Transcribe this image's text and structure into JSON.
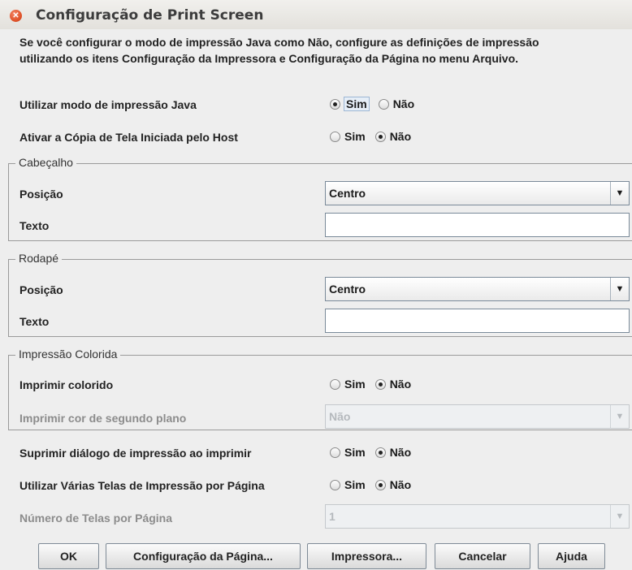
{
  "window": {
    "title": "Configuração de Print Screen",
    "close_icon": "close-icon"
  },
  "intro": "Se você configurar o modo de impressão Java como Não, configure as definições de impressão utilizando os itens Configuração da Impressora e Configuração da Página no menu Arquivo.",
  "java_mode": {
    "label": "Utilizar modo de impressão Java",
    "yes": "Sim",
    "no": "Não",
    "selected": "yes"
  },
  "host_copy": {
    "label": "Ativar a Cópia de Tela Iniciada pelo Host",
    "yes": "Sim",
    "no": "Não",
    "selected": "no"
  },
  "header": {
    "legend": "Cabeçalho",
    "position_label": "Posição",
    "position_value": "Centro",
    "text_label": "Texto",
    "text_value": ""
  },
  "footer": {
    "legend": "Rodapé",
    "position_label": "Posição",
    "position_value": "Centro",
    "text_label": "Texto",
    "text_value": ""
  },
  "color_print": {
    "legend": "Impressão Colorida",
    "print_color_label": "Imprimir colorido",
    "yes": "Sim",
    "no": "Não",
    "selected": "no",
    "bg_color_label": "Imprimir cor de segundo plano",
    "bg_color_value": "Não"
  },
  "suppress_dialog": {
    "label": "Suprimir diálogo de impressão ao imprimir",
    "yes": "Sim",
    "no": "Não",
    "selected": "no"
  },
  "multi_screens": {
    "label": "Utilizar Várias Telas de Impressão por Página",
    "yes": "Sim",
    "no": "Não",
    "selected": "no"
  },
  "screens_per_page": {
    "label": "Número de Telas por Página",
    "value": "1"
  },
  "buttons": {
    "ok": "OK",
    "page_setup": "Configuração da Página...",
    "printer": "Impressora...",
    "cancel": "Cancelar",
    "help": "Ajuda"
  }
}
